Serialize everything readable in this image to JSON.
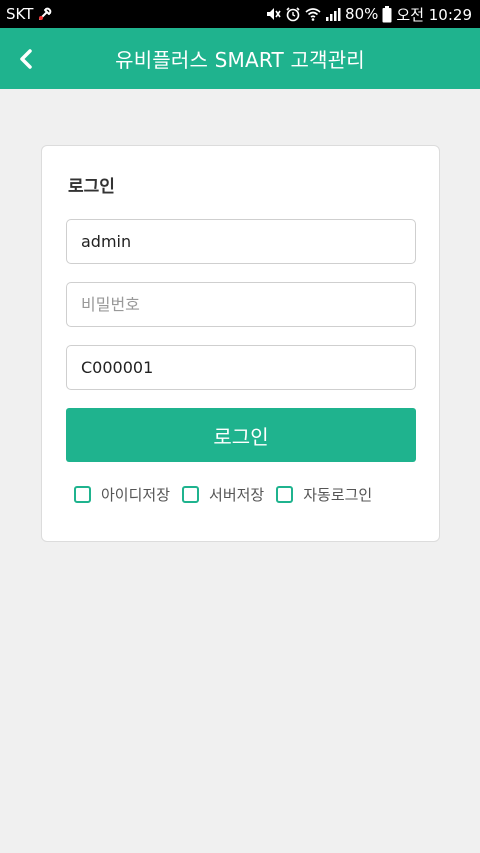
{
  "status_bar": {
    "carrier": "SKT",
    "battery": "80%",
    "time": "오전 10:29"
  },
  "app_bar": {
    "title": "유비플러스 SMART 고객관리"
  },
  "login_card": {
    "title": "로그인",
    "username_value": "admin",
    "password_placeholder": "비밀번호",
    "company_code_value": "C000001",
    "login_button_label": "로그인",
    "options": [
      {
        "label": "아이디저장",
        "checked": false
      },
      {
        "label": "서버저장",
        "checked": false
      },
      {
        "label": "자동로그인",
        "checked": false
      }
    ]
  },
  "colors": {
    "accent": "#1fb38e",
    "background": "#f0f0f0"
  }
}
